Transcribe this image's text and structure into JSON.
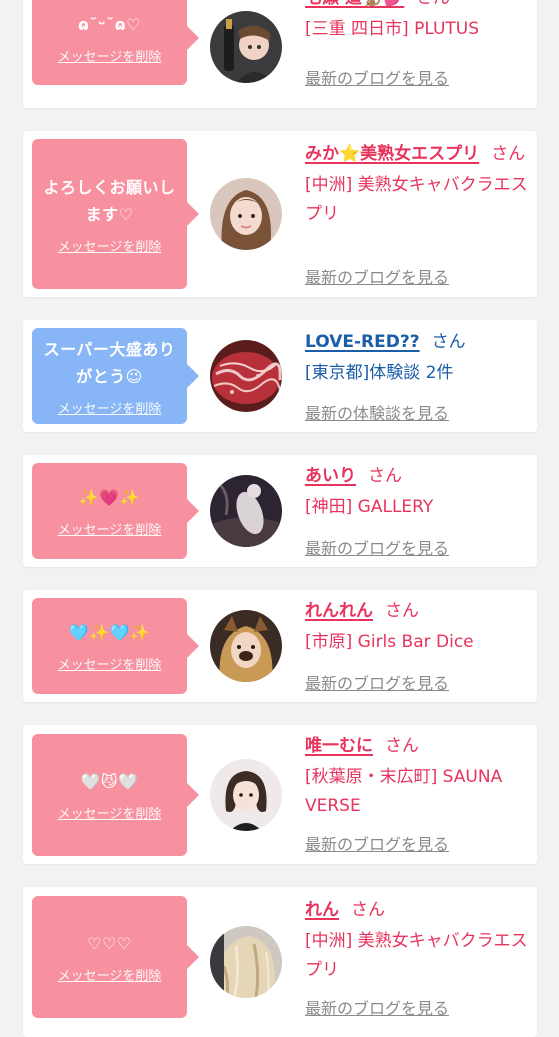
{
  "colors": {
    "bubble_pink": "#f7909f",
    "bubble_blue": "#88b5f5",
    "name_pink": "#e8345d",
    "name_blue": "#1b5ea8",
    "link_gray": "#8a8a8a",
    "background": "#f2f2f4"
  },
  "delete_label": "メッセージを削除",
  "san_label": "さん",
  "items": [
    {
      "message": "ɷ˘ᵕ˘ɷ♡",
      "bubble_color": "pink",
      "avatar_icon": "girl-with-bottle-avatar",
      "name": "七瀬 遥🐒💕",
      "name_color": "pink",
      "area": "[三重 四日市] PLUTUS",
      "link": "最新のブログを見る"
    },
    {
      "message": "よろしくお願いします♡",
      "bubble_color": "pink",
      "avatar_icon": "long-hair-selfie-avatar",
      "name": "みか⭐美熟女エスプリ",
      "name_color": "pink",
      "area": "[中洲] 美熟女キャバクラエスプリ",
      "link": "最新のブログを見る"
    },
    {
      "message": "スーパー大盛ありがとう😉",
      "bubble_color": "blue",
      "avatar_icon": "raw-meat-avatar",
      "name": "LOVE-RED??",
      "name_color": "blue",
      "area": "[東京都]体験談 2件",
      "link": "最新の体験談を見る"
    },
    {
      "message": "✨💗✨",
      "bubble_color": "pink",
      "avatar_icon": "dark-photo-avatar",
      "name": "あいり",
      "name_color": "pink",
      "area": "[神田] GALLERY",
      "link": "最新のブログを見る"
    },
    {
      "message": "🩵✨🩵✨",
      "bubble_color": "pink",
      "avatar_icon": "dog-filter-selfie-avatar",
      "name": "れんれん",
      "name_color": "pink",
      "area": "[市原] Girls Bar Dice",
      "link": "最新のブログを見る"
    },
    {
      "message": "🤍😼🤍",
      "bubble_color": "pink",
      "avatar_icon": "bob-hair-portrait-avatar",
      "name": "唯一むに",
      "name_color": "pink",
      "area": "[秋葉原・末広町] SAUNA VERSE",
      "link": "最新のブログを見る"
    },
    {
      "message": "♡♡♡",
      "bubble_color": "pink",
      "avatar_icon": "blonde-hair-avatar",
      "name": "れん",
      "name_color": "pink",
      "area": "[中洲] 美熟女キャバクラエスプリ",
      "link": "最新のブログを見る"
    }
  ]
}
